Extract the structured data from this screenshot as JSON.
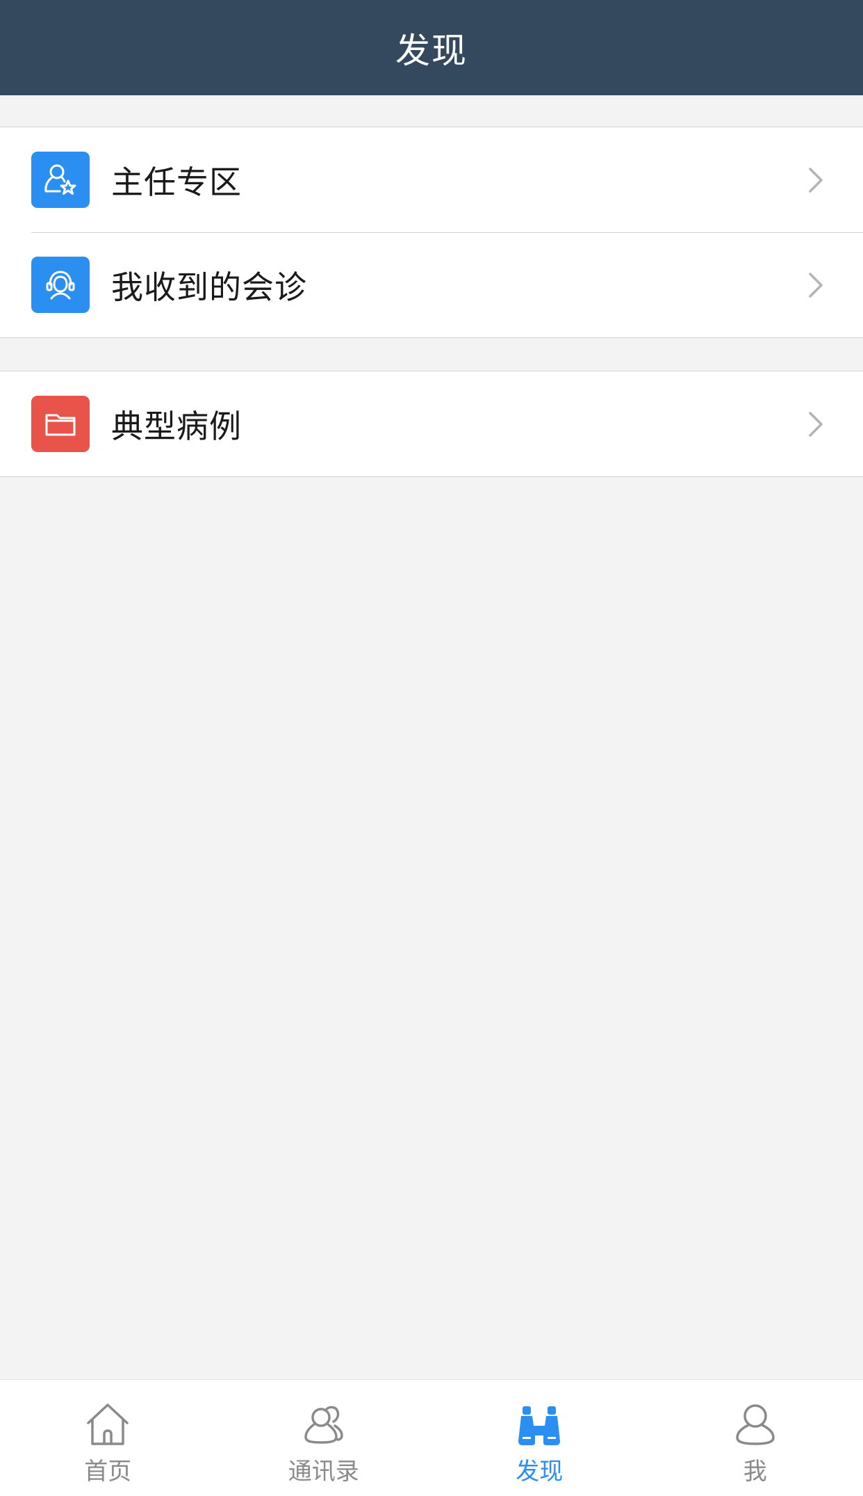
{
  "header": {
    "title": "发现"
  },
  "colors": {
    "nav_bg": "#34495e",
    "accent_blue": "#2a8ff0",
    "case_red": "#e8534a",
    "inactive_gray": "#8a8a8a"
  },
  "groups": [
    {
      "items": [
        {
          "label": "主任专区",
          "icon": "director-star-icon",
          "icon_color": "#2a8ff0"
        },
        {
          "label": "我收到的会诊",
          "icon": "consultation-headset-icon",
          "icon_color": "#2a8ff0"
        }
      ]
    },
    {
      "items": [
        {
          "label": "典型病例",
          "icon": "folder-icon",
          "icon_color": "#e8534a"
        }
      ]
    }
  ],
  "tabbar": {
    "items": [
      {
        "label": "首页",
        "icon": "home-icon",
        "active": false
      },
      {
        "label": "通讯录",
        "icon": "contacts-icon",
        "active": false
      },
      {
        "label": "发现",
        "icon": "binoculars-icon",
        "active": true
      },
      {
        "label": "我",
        "icon": "person-icon",
        "active": false
      }
    ]
  }
}
